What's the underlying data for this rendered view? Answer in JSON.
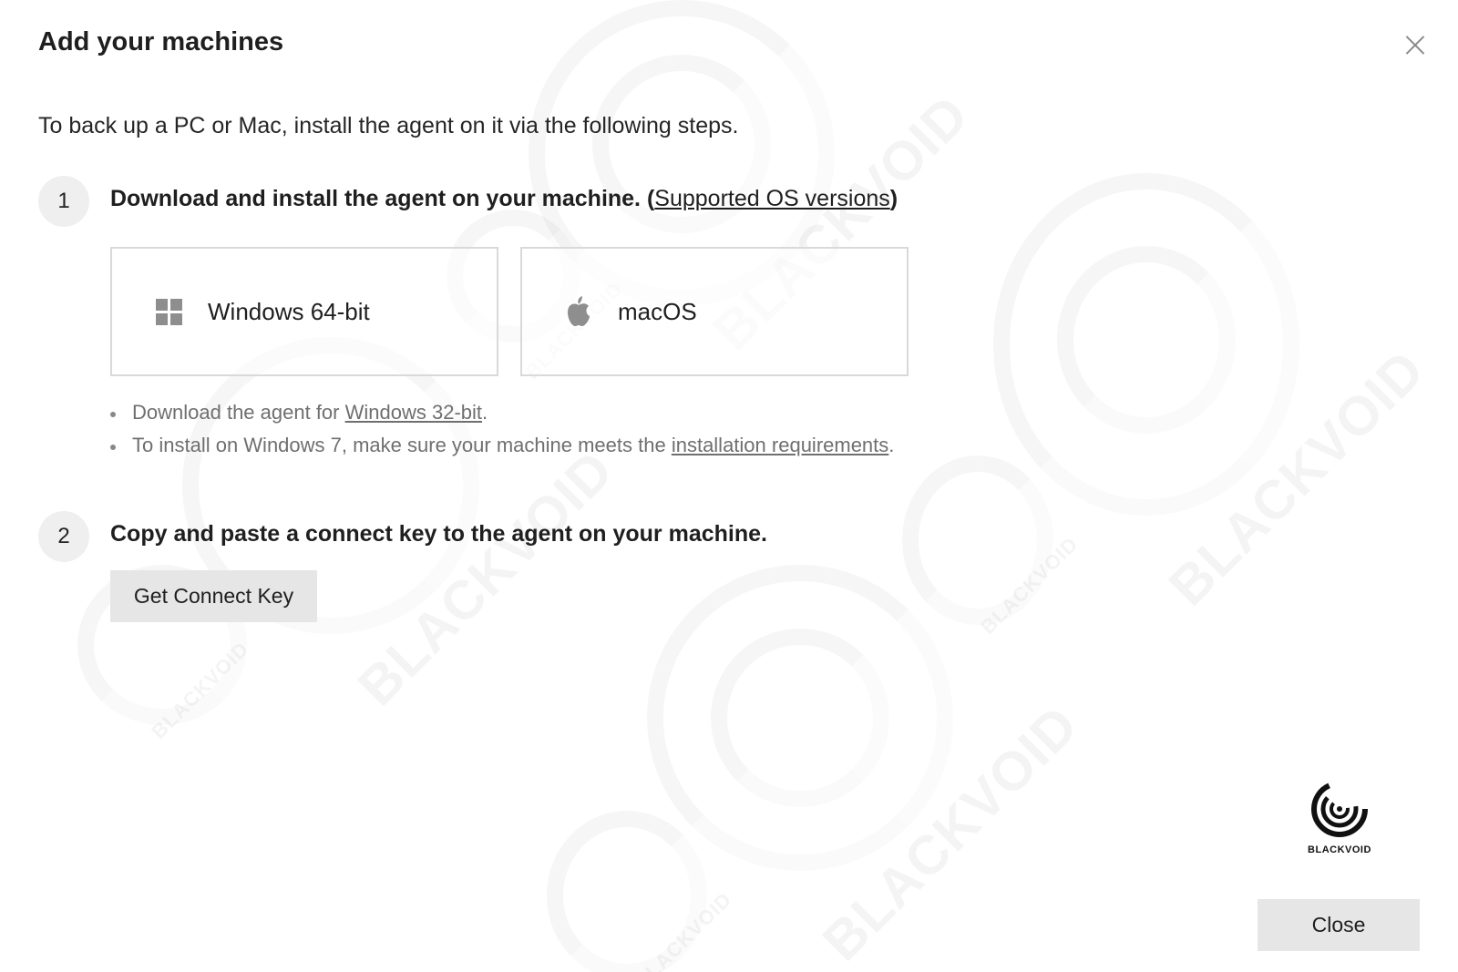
{
  "dialog": {
    "title": "Add your machines",
    "close_icon": "close-icon",
    "intro": "To back up a PC or Mac, install the agent on it via the following steps."
  },
  "step1": {
    "number": "1",
    "title": "Download and install the agent on your machine. (",
    "link": "Supported OS versions",
    "title_end": ")",
    "options": [
      {
        "label": "Windows 64-bit",
        "icon": "windows-icon"
      },
      {
        "label": "macOS",
        "icon": "apple-icon"
      }
    ],
    "notes": [
      {
        "prefix": "Download the agent for ",
        "link": "Windows 32-bit",
        "suffix": "."
      },
      {
        "prefix": "To install on Windows 7, make sure your machine meets the ",
        "link": "installation requirements",
        "suffix": "."
      }
    ]
  },
  "step2": {
    "number": "2",
    "title": "Copy and paste a connect key to the agent on your machine.",
    "button_label": "Get Connect Key"
  },
  "brand": {
    "name": "BLACKVOID",
    "icon": "swirl-logo-icon"
  },
  "footer": {
    "close_label": "Close"
  },
  "colors": {
    "button_bg": "#e6e6e6",
    "step_circle_bg": "#efefef",
    "card_border": "#d9d9d9",
    "muted_text": "#6f6f6f"
  }
}
